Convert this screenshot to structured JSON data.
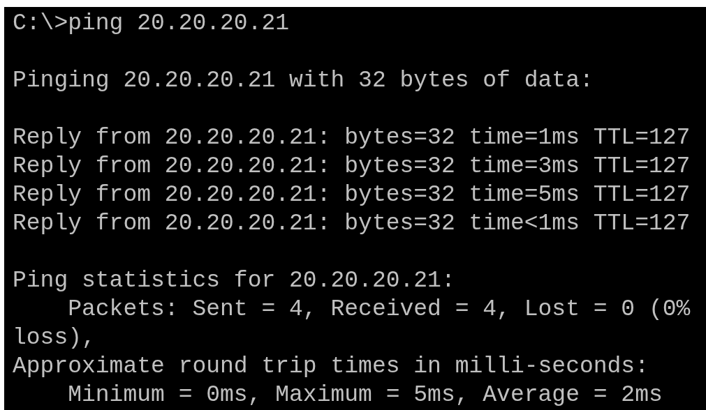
{
  "console": {
    "blocks": [
      {
        "lines": [
          "C:\\>ping 20.20.20.21"
        ]
      },
      {
        "lines": [
          "Pinging 20.20.20.21 with 32 bytes of data:"
        ]
      },
      {
        "lines": [
          "Reply from 20.20.20.21: bytes=32 time=1ms TTL=127",
          "Reply from 20.20.20.21: bytes=32 time=3ms TTL=127",
          "Reply from 20.20.20.21: bytes=32 time=5ms TTL=127",
          "Reply from 20.20.20.21: bytes=32 time<1ms TTL=127"
        ]
      },
      {
        "lines": [
          "Ping statistics for 20.20.20.21:",
          "    Packets: Sent = 4, Received = 4, Lost = 0 (0%",
          "loss),",
          "Approximate round trip times in milli-seconds:",
          "    Minimum = 0ms, Maximum = 5ms, Average = 2ms"
        ]
      }
    ]
  }
}
